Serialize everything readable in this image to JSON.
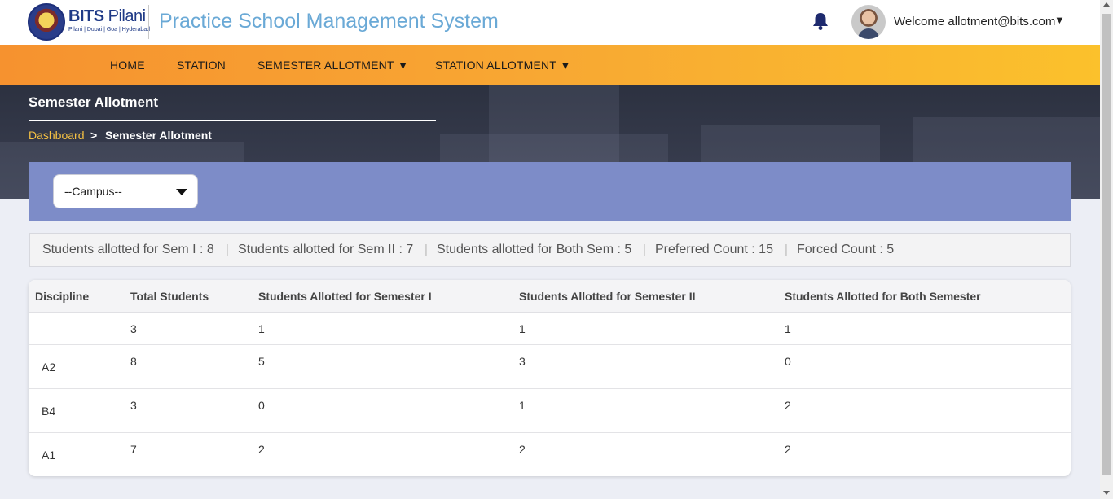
{
  "header": {
    "brand_name": "BITS",
    "brand_name_2": "Pilani",
    "brand_sub": "Pilani | Dubai | Goa | Hyderabad",
    "app_title": "Practice School Management System",
    "welcome": "Welcome allotment@bits.com",
    "user_caret": "▼"
  },
  "nav": {
    "items": [
      {
        "label": "HOME"
      },
      {
        "label": "STATION"
      },
      {
        "label": "SEMESTER ALLOTMENT ▼"
      },
      {
        "label": "STATION ALLOTMENT ▼"
      }
    ]
  },
  "banner": {
    "title": "Semester Allotment",
    "breadcrumb_link": "Dashboard",
    "breadcrumb_sep": ">",
    "breadcrumb_current": "Semester Allotment"
  },
  "filter": {
    "campus_value": "--Campus--"
  },
  "stats": {
    "sem1": "Students allotted for Sem I : 8",
    "sem2": "Students allotted for Sem II : 7",
    "both": "Students allotted for Both Sem : 5",
    "preferred": "Preferred Count : 15",
    "forced": "Forced Count : 5",
    "separator": "|"
  },
  "table": {
    "headers": [
      "Discipline",
      "Total Students",
      "Students Allotted for Semester I",
      "Students Allotted for Semester II",
      "Students Allotted for Both Semester"
    ],
    "rows": [
      {
        "discipline": "",
        "total": "3",
        "sem1": "1",
        "sem2": "1",
        "both": "1"
      },
      {
        "discipline": "A2",
        "total": "8",
        "sem1": "5",
        "sem2": "3",
        "both": "0"
      },
      {
        "discipline": "B4",
        "total": "3",
        "sem1": "0",
        "sem2": "1",
        "both": "2"
      },
      {
        "discipline": "A1",
        "total": "7",
        "sem1": "2",
        "sem2": "2",
        "both": "2"
      }
    ]
  },
  "colors": {
    "nav_gradient_start": "#f6922f",
    "nav_gradient_end": "#fbc12c",
    "banner": "#2c3140",
    "filter_panel": "#7d8cc8",
    "title_blue": "#6aa9d6",
    "breadcrumb_link": "#f6c243"
  },
  "icons": {
    "logo": "bits-pilani-seal",
    "bell": "bell-icon",
    "avatar": "user-avatar",
    "dropdown": "caret-down-icon"
  }
}
